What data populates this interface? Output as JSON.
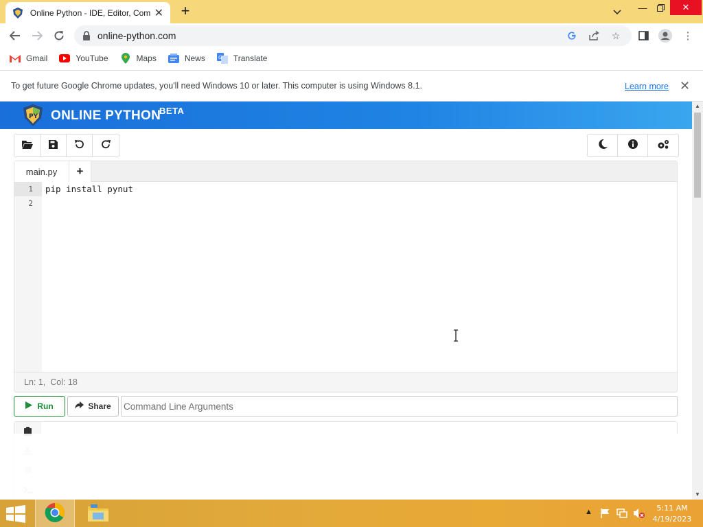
{
  "browser": {
    "tab_title": "Online Python - IDE, Editor, Compiler",
    "url": "online-python.com",
    "bookmarks": [
      {
        "label": "Gmail",
        "icon": "gmail-icon"
      },
      {
        "label": "YouTube",
        "icon": "youtube-icon"
      },
      {
        "label": "Maps",
        "icon": "maps-icon"
      },
      {
        "label": "News",
        "icon": "news-icon"
      },
      {
        "label": "Translate",
        "icon": "translate-icon"
      }
    ],
    "infobar_message": "To get future Google Chrome updates, you'll need Windows 10 or later. This computer is using Windows 8.1.",
    "infobar_link": "Learn more"
  },
  "site": {
    "brand": "ONLINE PYTHON",
    "badge": "BETA",
    "logo_text": "PY"
  },
  "toolbar_left": [
    "open-folder-icon",
    "save-icon",
    "undo-icon",
    "redo-icon"
  ],
  "toolbar_right": [
    "moon-icon",
    "info-icon",
    "settings-icon"
  ],
  "editor": {
    "file_tab": "main.py",
    "add_tab": "+",
    "line_numbers": [
      "1",
      "2"
    ],
    "code_line_1": "pip install pynut",
    "status": "Ln: 1,  Col: 18"
  },
  "actions": {
    "run_label": "Run",
    "share_label": "Share",
    "args_placeholder": "Command Line Arguments"
  },
  "taskbar": {
    "time": "5:11 AM",
    "date": "4/19/2023"
  },
  "colors": {
    "header_blue": "#1f84e4",
    "run_green": "#1e8c3a",
    "tab_strip": "#f6d87a",
    "taskbar": "#e2a93a",
    "link": "#1a73e8"
  }
}
